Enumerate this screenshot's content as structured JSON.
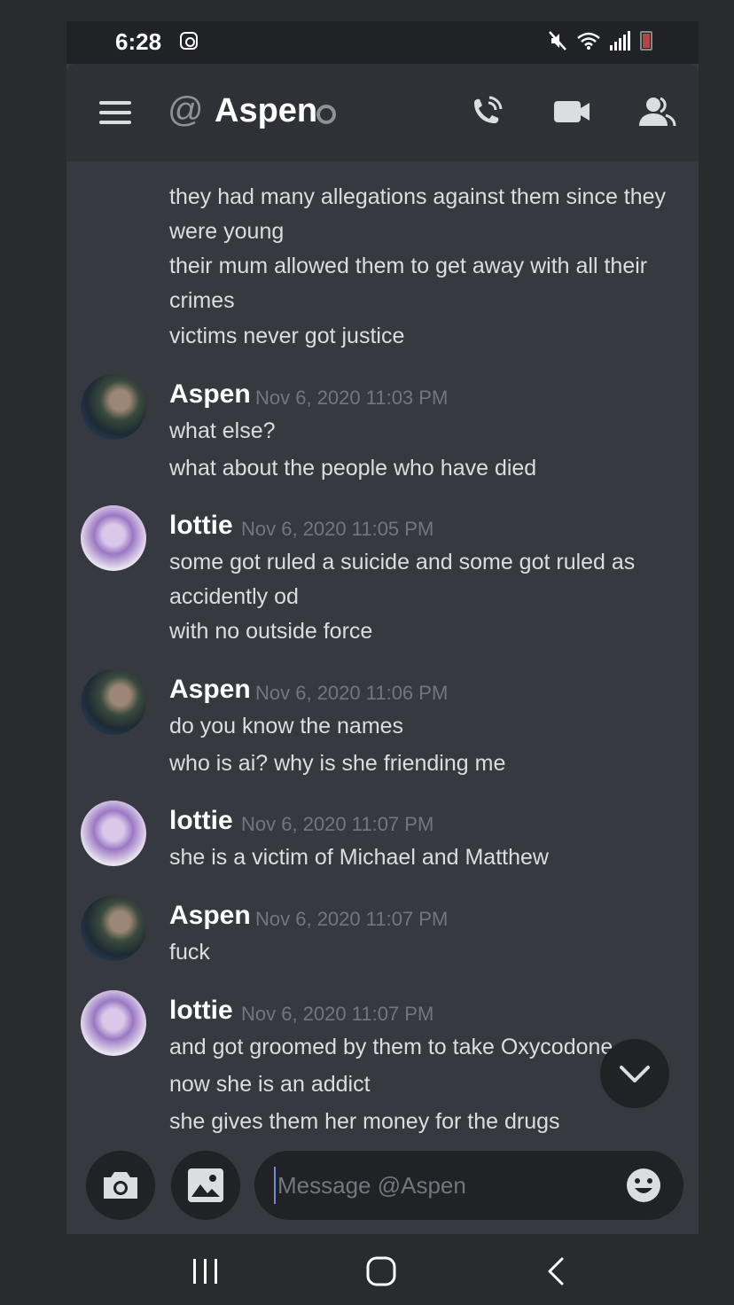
{
  "status_bar": {
    "time": "6:28",
    "icons": [
      "instagram-icon",
      "mute-icon",
      "wifi-icon",
      "signal-icon",
      "battery-low-icon"
    ]
  },
  "header": {
    "menu_icon": "hamburger-icon",
    "at_symbol": "@",
    "title": "Aspen",
    "presence": "offline",
    "actions": [
      "voice-call-icon",
      "video-call-icon",
      "members-icon"
    ]
  },
  "messages": {
    "continuation": {
      "lines": [
        "they had many allegations against them since they",
        "were young",
        "their mum allowed them to get away with all their",
        "crimes",
        "victims never got justice"
      ]
    },
    "groups": [
      {
        "author": "Aspen",
        "timestamp": "Nov 6, 2020 11:03 PM",
        "lines": [
          "what else?",
          "what about the people who have died"
        ]
      },
      {
        "author": "lottie",
        "timestamp": "Nov 6, 2020 11:05 PM",
        "lines": [
          "some got ruled a suicide and some got ruled as",
          "accidently od",
          "with no outside force"
        ]
      },
      {
        "author": "Aspen",
        "timestamp": "Nov 6, 2020 11:06 PM",
        "lines": [
          "do you know the names",
          "who is ai? why is she friending me"
        ]
      },
      {
        "author": "lottie",
        "timestamp": "Nov 6, 2020 11:07 PM",
        "lines": [
          "she is a victim of Michael and Matthew"
        ]
      },
      {
        "author": "Aspen",
        "timestamp": "Nov 6, 2020 11:07 PM",
        "lines": [
          "fuck"
        ]
      },
      {
        "author": "lottie",
        "timestamp": "Nov 6, 2020 11:07 PM",
        "lines": [
          "and got groomed by them to take Oxycodone",
          "now she is an addict",
          "she gives them her money for the drugs"
        ]
      }
    ]
  },
  "composer": {
    "placeholder": "Message @Aspen",
    "value": "",
    "camera_icon": "camera-icon",
    "gallery_icon": "image-icon",
    "emoji_icon": "emoji-icon",
    "scroll_icon": "chevron-down-icon"
  },
  "nav_bar": {
    "buttons": [
      "recent-apps-icon",
      "home-icon",
      "back-icon"
    ]
  },
  "colors": {
    "background": "#36393f",
    "header": "#2f3136",
    "input": "#202225",
    "text": "#dcddde",
    "timestamp": "#72767d",
    "accent": "#7289da"
  }
}
